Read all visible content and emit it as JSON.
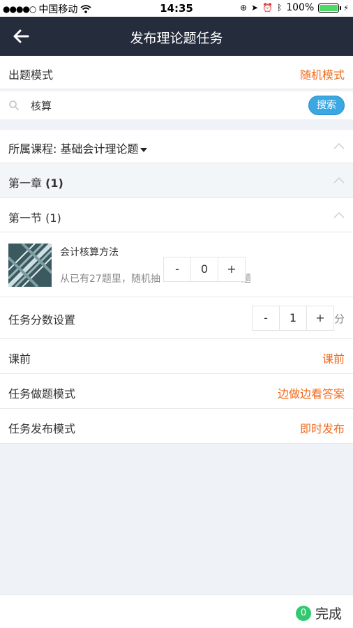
{
  "status_bar": {
    "carrier": "中国移动",
    "time": "14:35",
    "battery": "100%",
    "signal_icon": "signal-dots-icon",
    "wifi_icon": "wifi-icon"
  },
  "nav": {
    "title": "发布理论题任务",
    "back_icon": "arrow-left-icon"
  },
  "question_mode": {
    "label": "出题模式",
    "value": "随机模式"
  },
  "search": {
    "query": "核算",
    "button": "搜索"
  },
  "course": {
    "label": "所属课程: 基础会计理论题"
  },
  "chapter": {
    "label": "第一章",
    "count": "(1)"
  },
  "section": {
    "label": "第一节 (1)"
  },
  "item": {
    "title": "会计核算方法",
    "desc": "从已有27题里，随机抽",
    "desc_tail": "题",
    "stepper": {
      "minus": "-",
      "value": "0",
      "plus": "+"
    }
  },
  "score": {
    "label": "任务分数设置",
    "stepper": {
      "minus": "-",
      "value": "1",
      "plus": "+"
    },
    "unit": "分"
  },
  "timing": {
    "label": "课前",
    "value": "课前"
  },
  "task_mode": {
    "label": "任务做题模式",
    "value": "边做边看答案"
  },
  "publish_mode": {
    "label": "任务发布模式",
    "value": "即时发布"
  },
  "footer": {
    "count": "0",
    "done": "完成"
  },
  "colors": {
    "navbar": "#252c3c",
    "accent_orange": "#f06a1d",
    "search_button": "#3aa8e2",
    "badge_green": "#32c870"
  }
}
